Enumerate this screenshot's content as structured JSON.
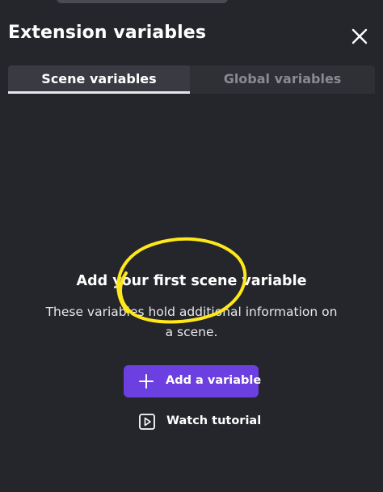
{
  "panel": {
    "title": "Extension variables",
    "close_icon": "close-icon"
  },
  "tabs": [
    {
      "label": "Scene variables",
      "active": true
    },
    {
      "label": "Global variables",
      "active": false
    }
  ],
  "empty_state": {
    "title": "Add your first scene variable",
    "description": "These variables hold additional information on a scene."
  },
  "actions": {
    "add_label": "Add a variable",
    "add_icon": "plus-icon",
    "tutorial_label": "Watch tutorial",
    "tutorial_icon": "play-icon"
  },
  "colors": {
    "background": "#25252c",
    "accent": "#6b3fe0",
    "annotation": "#ffe81a"
  }
}
